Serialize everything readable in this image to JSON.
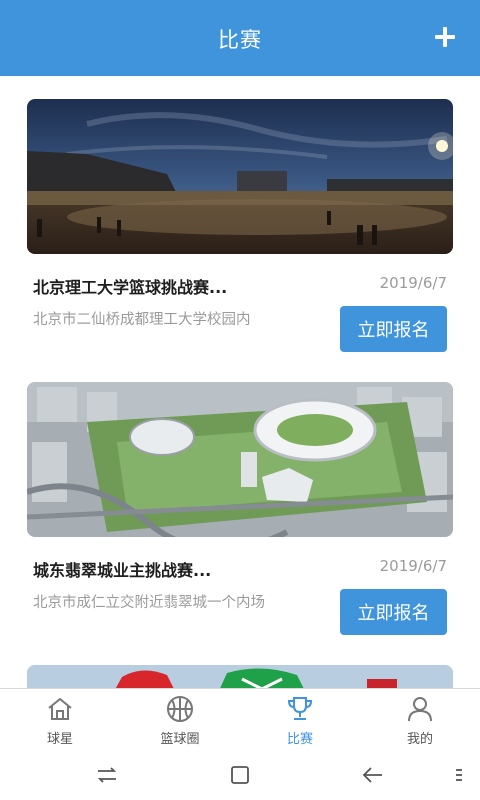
{
  "header": {
    "title": "比赛",
    "add_icon": "plus-icon"
  },
  "colors": {
    "primary": "#3f94dc",
    "muted_text": "#9b9b9b",
    "title_text": "#1e1e1e"
  },
  "cards": [
    {
      "title": "北京理工大学篮球挑战赛...",
      "date": "2019/6/7",
      "address": "北京市二仙桥成都理工大学校园内",
      "button": "立即报名",
      "image": "night-stadium-photo"
    },
    {
      "title": "城东翡翠城业主挑战赛...",
      "date": "2019/6/7",
      "address": "北京市成仁立交附近翡翠城一个内场",
      "button": "立即报名",
      "image": "sports-complex-aerial-photo"
    },
    {
      "image": "football-players-photo"
    }
  ],
  "tabs": [
    {
      "label": "球星",
      "icon": "home-icon",
      "active": false
    },
    {
      "label": "篮球圈",
      "icon": "basketball-icon",
      "active": false
    },
    {
      "label": "比赛",
      "icon": "trophy-icon",
      "active": true
    },
    {
      "label": "我的",
      "icon": "user-icon",
      "active": false
    }
  ],
  "system_nav": [
    "switch-apps-icon",
    "home-square-icon",
    "back-icon",
    "more-icon"
  ]
}
